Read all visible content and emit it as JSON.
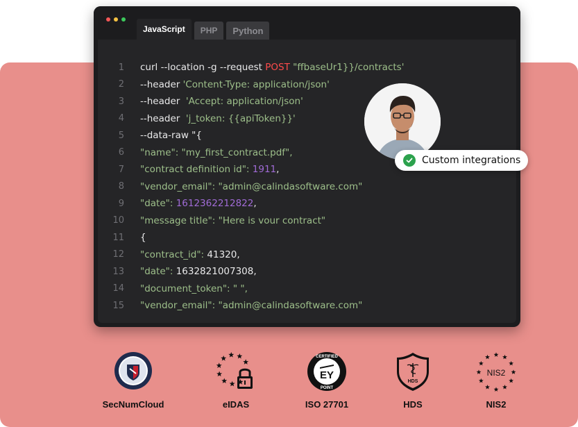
{
  "editor": {
    "window_dots": [
      "#f25757",
      "#f5c243",
      "#3cc95c"
    ],
    "tabs": [
      {
        "label": "JavaScript",
        "active": true
      },
      {
        "label": "PHP",
        "active": false
      },
      {
        "label": "Python",
        "active": false
      }
    ],
    "line_numbers": [
      "1",
      "2",
      "3",
      "4",
      "5",
      "6",
      "7",
      "8",
      "9",
      "10",
      "11",
      "12",
      "13",
      "14",
      "15"
    ],
    "lines": [
      [
        {
          "t": "curl --location -g --request ",
          "c": "w"
        },
        {
          "t": "POST",
          "c": "r"
        },
        {
          "t": " \"ffbaseUr1}}/contracts'",
          "c": "g"
        }
      ],
      [
        {
          "t": "--header ",
          "c": "w"
        },
        {
          "t": "'Content-Type: application/json'",
          "c": "g"
        }
      ],
      [
        {
          "t": "--header  ",
          "c": "w"
        },
        {
          "t": "'Accept: application/json'",
          "c": "g"
        }
      ],
      [
        {
          "t": "--header  ",
          "c": "w"
        },
        {
          "t": "'j_token: {{apiToken}}'",
          "c": "g"
        }
      ],
      [
        {
          "t": "--data-raw \"{",
          "c": "w"
        }
      ],
      [
        {
          "t": "\"name\": \"my_first_contract.pdf\",",
          "c": "g"
        }
      ],
      [
        {
          "t": "\"contract definition id\": ",
          "c": "g"
        },
        {
          "t": "1911",
          "c": "p"
        },
        {
          "t": ",",
          "c": "w"
        }
      ],
      [
        {
          "t": "\"vendor_email\": \"admin@calindasoftware.com\"",
          "c": "g"
        }
      ],
      [
        {
          "t": "\"date\": ",
          "c": "g"
        },
        {
          "t": "1612362212822",
          "c": "p"
        },
        {
          "t": ",",
          "c": "w"
        }
      ],
      [
        {
          "t": "\"message title\": \"Here is vour contract\"",
          "c": "g"
        }
      ],
      [
        {
          "t": "{",
          "c": "w"
        }
      ],
      [
        {
          "t": "\"contract_id\": ",
          "c": "g"
        },
        {
          "t": "41320,",
          "c": "w"
        }
      ],
      [
        {
          "t": "\"date\": ",
          "c": "g"
        },
        {
          "t": "1632821007308,",
          "c": "w"
        }
      ],
      [
        {
          "t": "\"document_token\": \" \",",
          "c": "g"
        }
      ],
      [
        {
          "t": "\"vendor_email\": ",
          "c": "g"
        },
        {
          "t": "\"admin@calindasoftware.com\"",
          "c": "g"
        }
      ]
    ]
  },
  "profile": {
    "badge_text": "Custom integrations",
    "badge_color": "#2ca24d"
  },
  "certifications": [
    {
      "label": "SecNumCloud",
      "icon": "secnumcloud-logo"
    },
    {
      "label": "eIDAS",
      "icon": "eidas-stars-lock-icon"
    },
    {
      "label": "ISO 27701",
      "icon": "ey-certified-point-seal",
      "seal_text": "EY",
      "seal_ring_top": "CERTIFIED",
      "seal_ring_bottom": "POINT"
    },
    {
      "label": "HDS",
      "icon": "hds-shield-icon",
      "shield_text": "HDS"
    },
    {
      "label": "NIS2",
      "icon": "nis2-stars-icon",
      "inner_text": "NIS2"
    }
  ],
  "colors": {
    "panel": "#e88f8b",
    "editor_bg": "#1c1c1e",
    "code_bg": "#252527",
    "string": "#9dbf8a",
    "keyword": "#ff4b4b",
    "number": "#a06bd6"
  }
}
